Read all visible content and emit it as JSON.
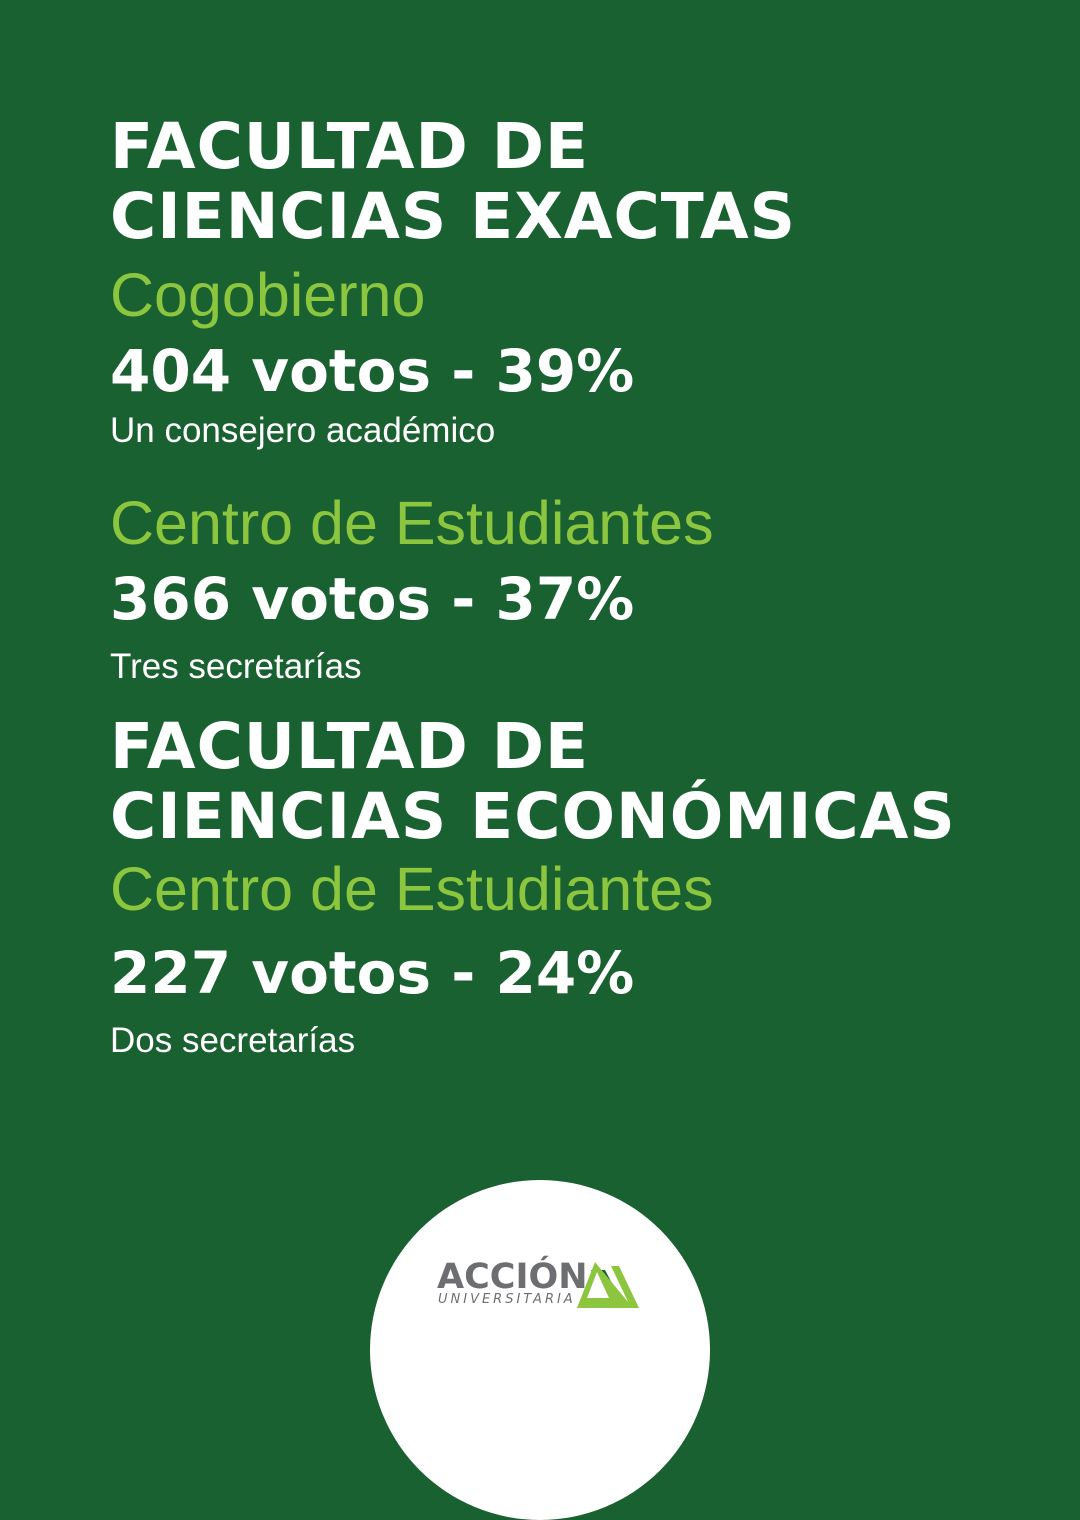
{
  "colors": {
    "background": "#196131",
    "accent": "#8cc63f",
    "text": "#ffffff",
    "logo_gray": "#6d6e71"
  },
  "section1": {
    "title_line1": "FACULTAD DE",
    "title_line2": "CIENCIAS EXACTAS",
    "block1": {
      "label": "Cogobierno",
      "votes": "404 votos - 39%",
      "note": "Un consejero académico"
    },
    "block2": {
      "label": "Centro de Estudiantes",
      "votes": "366 votos - 37%",
      "note": "Tres secretarías"
    }
  },
  "section2": {
    "title_line1": "FACULTAD DE",
    "title_line2": "CIENCIAS ECONÓMICAS",
    "block1": {
      "label": "Centro de Estudiantes",
      "votes": "227 votos - 24%",
      "note": "Dos secretarías"
    }
  },
  "logo": {
    "main": "ACCIÓN",
    "sub": "UNIVERSITARIA",
    "icon": "mountain-logo-icon"
  }
}
